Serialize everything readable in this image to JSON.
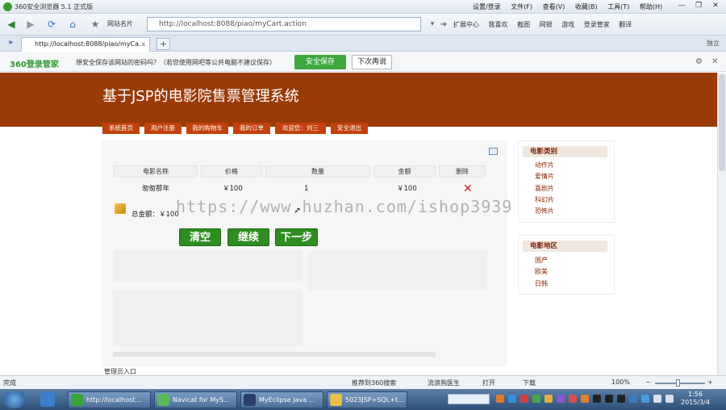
{
  "browser": {
    "window_title": "360安全浏览器 5.1 正式版",
    "menus": [
      "设置/登录",
      "文件(F)",
      "查看(V)",
      "收藏(B)",
      "工具(T)",
      "帮助(H)"
    ],
    "window_buttons": [
      "—",
      "❐",
      "✕"
    ],
    "favorites_label": "网站名片",
    "address": "http://localhost:8088/piao/myCart.action",
    "toolbar_right": [
      "扩展中心",
      "我喜欢",
      "截图",
      "网银",
      "游戏",
      "登录管家",
      "翻译"
    ],
    "tab_title": "http://localhost:8088/piao/myCa...",
    "tab_add": "+",
    "tab_close": "×",
    "tab_right": "独立"
  },
  "password_bar": {
    "brand": "360登录管家",
    "message": "想安全保存该网站的密码吗？（若您使用网吧等公共电脑不建议保存）",
    "save_button": "安全保存",
    "later_button": "下次再说",
    "settings_icon": "⚙",
    "close_icon": "✕"
  },
  "site": {
    "title": "基于JSP的电影院售票管理系统",
    "menu": [
      "系统首页",
      "用户注册",
      "我的购物车",
      "我的订单",
      "欢迎您：刘三",
      "安全退出"
    ],
    "admin_link": "管理员入口"
  },
  "cart": {
    "columns": [
      "电影名称",
      "价格",
      "数量",
      "金额",
      "删除"
    ],
    "rows": [
      {
        "name": "匆匆那年",
        "price": "￥100",
        "qty": "1",
        "amount": "￥100",
        "delete": "✕"
      }
    ],
    "total": "总金额：￥100",
    "buttons": [
      "清空",
      "继续",
      "下一步"
    ]
  },
  "sidebar": {
    "category_title": "电影类别",
    "categories": [
      "动作片",
      "爱情片",
      "喜剧片",
      "科幻片",
      "恐怖片"
    ],
    "region_title": "电影地区",
    "regions": [
      "国产",
      "欧美",
      "日韩"
    ]
  },
  "watermark": "https://www.huzhan.com/ishop3939",
  "statusbar": {
    "left": "完成",
    "items": [
      "推荐到360搜索",
      "流浪狗医生",
      "打开",
      "下载"
    ],
    "zoom": "100%",
    "zoom_minus": "−",
    "zoom_plus": "+"
  },
  "taskbar": {
    "items": [
      "http://localhost...",
      "Navicat for MyS...",
      "MyEclipse Java ...",
      "5023JSP+SQL+t..."
    ],
    "time": "1:56",
    "date": "2015/3/4"
  },
  "colors": {
    "header": "#9a3a07",
    "menu": "#c2410c",
    "button_green": "#2f8d22",
    "delete_red": "#d21f1f"
  }
}
